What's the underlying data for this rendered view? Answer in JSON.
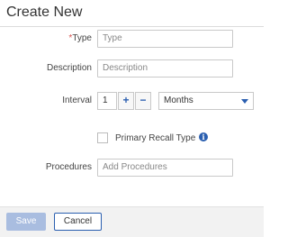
{
  "header": {
    "title": "Create New"
  },
  "form": {
    "type": {
      "required_mark": "*",
      "label": "Type",
      "placeholder": "Type"
    },
    "description": {
      "label": "Description",
      "placeholder": "Description"
    },
    "interval": {
      "label": "Interval",
      "value": "1",
      "increment_label": "+",
      "decrement_label": "−",
      "unit_selected": "Months"
    },
    "primary_recall": {
      "label": "Primary Recall Type",
      "checked": false,
      "info_glyph": "i"
    },
    "procedures": {
      "label": "Procedures",
      "placeholder": "Add Procedures"
    }
  },
  "footer": {
    "save_label": "Save",
    "cancel_label": "Cancel"
  },
  "colors": {
    "accent": "#2b5fb0",
    "required": "#d9534f",
    "save_disabled": "#a9bde0"
  }
}
